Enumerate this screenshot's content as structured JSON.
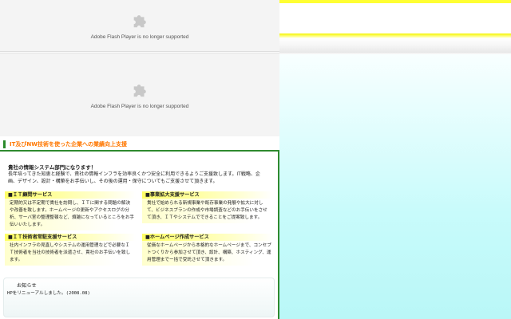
{
  "flash": {
    "message_1": "Adobe Flash Player is no longer supported",
    "message_2": "Adobe Flash Player is no longer supported",
    "icon": "puzzle-piece-icon"
  },
  "section": {
    "title": "IT及びNW技術を使った企業への業績向上支援"
  },
  "intro": {
    "heading": "貴社の情報システム部門になります！",
    "text": "長年培ってきた知恵と経験で、貴社の情報インフラを効率良くかつ安全に利用できるようご支援致します。IT戦略、企画、デザイン、設計・構築をお手伝いし、その後の運用・保守についてもご支援させて頂きます。"
  },
  "services": [
    {
      "title": "■ＩＴ顧問サービス",
      "body": "定期的又は不定期で貴社を訪問し、ＩＴに関する問題の解決や改善を致します。ホームページの更新やアクセスログの分析、サーバ室の整理整頓など、煩雑になっているところをお手伝いいたします。"
    },
    {
      "title": "■事業拡大支援サービス",
      "body": "貴社で始められる新規事業や既存事業の発展や拡大に対して、ビジネスプランの作成や市場調査などのお手伝いをさせて頂き、ＩＴやシステムでできることをご提案致します。"
    },
    {
      "title": "■ＩＴ技術者常駐支援サービス",
      "body": "社内インフラの見直しやシステムの運用管理などで必要なＩＴ技術者を当社の技術者を派遣させ、貴社のお手伝いを致します。"
    },
    {
      "title": "■ホームページ作成サービス",
      "body": "従価なホームページから本格的なホームページまで、コンセプトつくりから参加させて頂き、設計、構築、ホスティング、運用管理までー括で受託させて頂きます。"
    }
  ],
  "news": {
    "title": "お知らせ",
    "items": [
      "HPをリニューアルしました。(2008.08)"
    ]
  },
  "colors": {
    "accent_green": "#2f8a2f",
    "title_orange": "#ff7700",
    "highlight_yellow": "#ffff66",
    "side_cyan": "#c8fbfb"
  }
}
